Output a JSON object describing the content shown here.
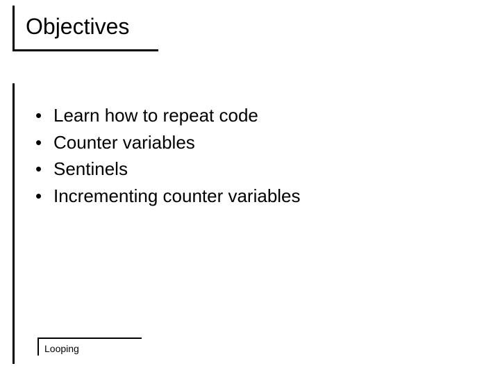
{
  "title": "Objectives",
  "bullets": [
    "Learn how to repeat code",
    "Counter variables",
    "Sentinels",
    "Incrementing counter variables"
  ],
  "footer": "Looping"
}
